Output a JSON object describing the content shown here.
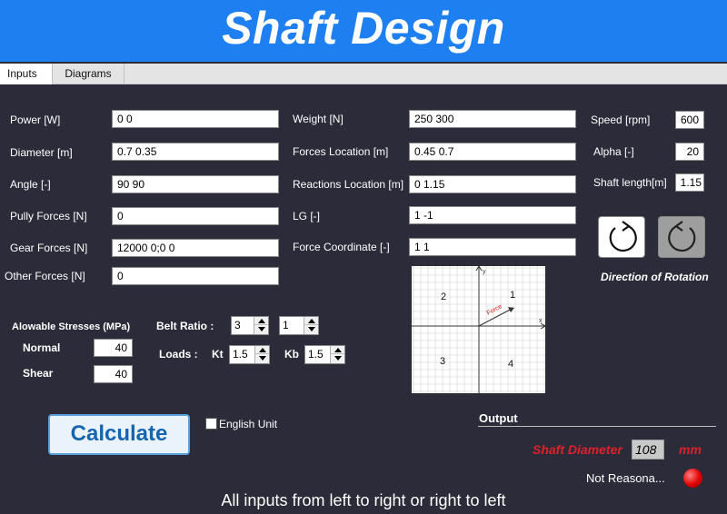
{
  "app": {
    "title": "Shaft Design"
  },
  "tabs": [
    {
      "label": "Inputs",
      "active": true
    },
    {
      "label": "Diagrams",
      "active": false
    }
  ],
  "col1": [
    {
      "label": "Power [W]",
      "value": "0 0"
    },
    {
      "label": "Diameter [m]",
      "value": "0.7 0.35"
    },
    {
      "label": "Angle [-]",
      "value": "90 90"
    },
    {
      "label": "Pully Forces [N]",
      "value": "0"
    },
    {
      "label": "Gear Forces [N]",
      "value": "12000 0;0 0"
    },
    {
      "label": "Other Forces [N]",
      "value": "0"
    }
  ],
  "col2": [
    {
      "label": "Weight [N]",
      "value": "250 300"
    },
    {
      "label": "Forces Location [m]",
      "value": "0.45 0.7"
    },
    {
      "label": "Reactions Location [m]",
      "value": "0 1.15"
    },
    {
      "label": "LG [-]",
      "value": "1 -1"
    },
    {
      "label": "Force Coordinate [-]",
      "value": "1 1"
    }
  ],
  "col3": [
    {
      "label": "Speed [rpm]",
      "value": "600"
    },
    {
      "label": "Alpha [-]",
      "value": "20"
    },
    {
      "label": "Shaft length[m]",
      "value": "1.15"
    }
  ],
  "rotation": {
    "label": "Direction of Rotation",
    "cw_icon": "rotate-clockwise-icon",
    "ccw_icon": "rotate-counterclockwise-icon"
  },
  "stresses": {
    "title": "Alowable Stresses (MPa)",
    "normal_label": "Normal",
    "normal_value": "40",
    "shear_label": "Shear",
    "shear_value": "40"
  },
  "belt": {
    "label": "Belt Ratio :",
    "value1": "3",
    "value2": "1"
  },
  "loads": {
    "label": "Loads :",
    "kt_label": "Kt",
    "kt_value": "1.5",
    "kb_label": "Kb",
    "kb_value": "1.5"
  },
  "diagram": {
    "q1": "1",
    "q2": "2",
    "q3": "3",
    "q4": "4",
    "force_label": "Force",
    "x_axis": "x",
    "y_axis": "y"
  },
  "calculate_label": "Calculate",
  "english_unit_label": "English Unit",
  "output": {
    "title": "Output",
    "shaft_diameter_label": "Shaft Diameter",
    "shaft_diameter_value": "108",
    "unit": "mm",
    "status_text": "Not Reasona..."
  },
  "footer": "All inputs from left to right or right to left",
  "colors": {
    "accent": "#1e7ff0",
    "background": "#2b2b3a",
    "output_red": "#e0202a",
    "button_text": "#1565b0"
  }
}
